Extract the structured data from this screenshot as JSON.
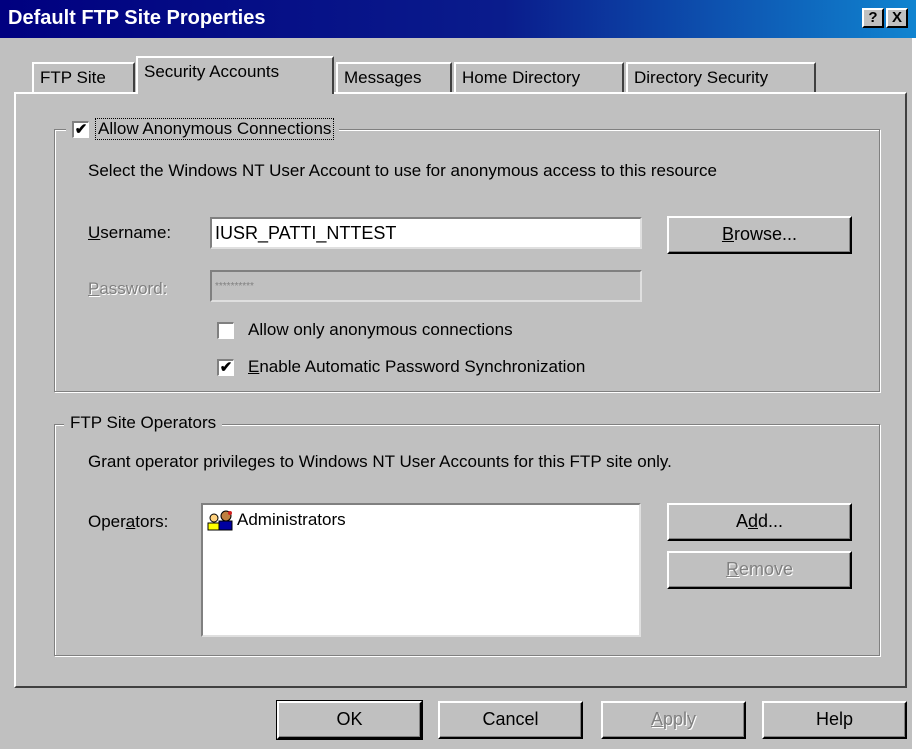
{
  "window": {
    "title": "Default FTP Site Properties",
    "help_glyph": "?",
    "close_glyph": "X"
  },
  "tabs": [
    {
      "label": "FTP Site",
      "active": false
    },
    {
      "label": "Security Accounts",
      "active": true
    },
    {
      "label": "Messages",
      "active": false
    },
    {
      "label": "Home Directory",
      "active": false
    },
    {
      "label": "Directory Security",
      "active": false
    }
  ],
  "anonymous": {
    "checkbox_label": "Allow Anonymous Connections",
    "checked": true,
    "description": "Select the Windows NT User Account to use for anonymous access to this resource",
    "username_label": "sername:",
    "username_label_ul": "U",
    "username_value": "IUSR_PATTI_NTTEST",
    "browse_label": "rowse...",
    "browse_label_ul": "B",
    "password_label": "assword:",
    "password_label_ul": "P",
    "password_value": "**********",
    "only_anonymous_label": "Allow only anonymous connections",
    "only_anonymous_checked": false,
    "sync_label": "nable Automatic Password Synchronization",
    "sync_label_ul": "E",
    "sync_checked": true,
    "check_glyph": "✔"
  },
  "operators": {
    "group_title": "FTP Site Operators",
    "description": "Grant operator privileges to Windows NT User Accounts for this FTP site only.",
    "label_pre": "Oper",
    "label_ul": "a",
    "label_post": "tors:",
    "items": [
      {
        "name": "Administrators",
        "icon": "user-group-icon"
      }
    ],
    "add_pre": "A",
    "add_ul": "d",
    "add_post": "d...",
    "remove_ul": "R",
    "remove_post": "emove"
  },
  "footer": {
    "ok": "OK",
    "cancel": "Cancel",
    "apply_ul": "A",
    "apply_post": "pply",
    "help": "Help"
  }
}
